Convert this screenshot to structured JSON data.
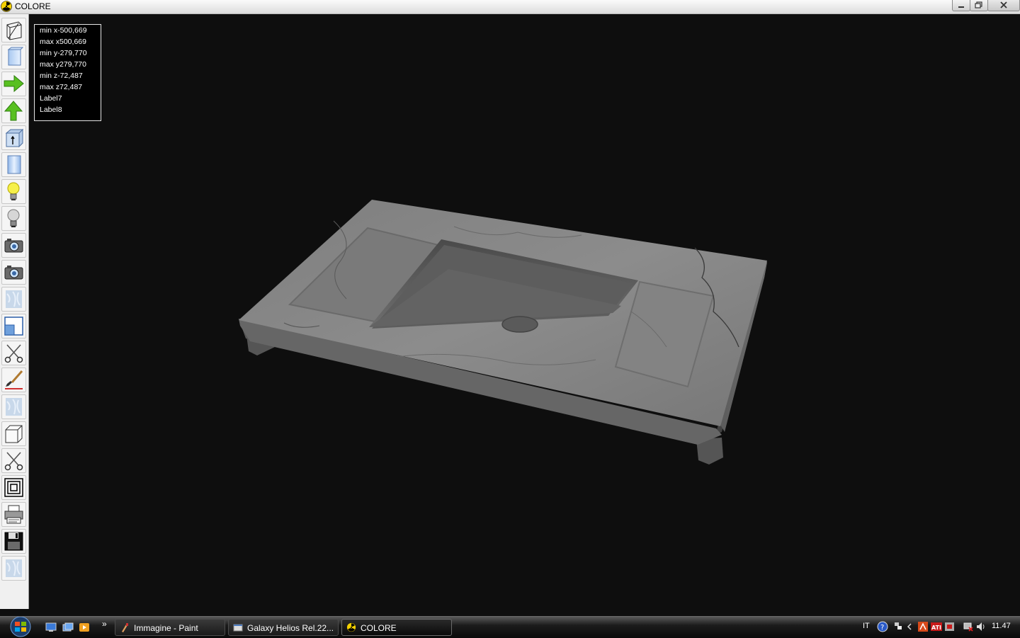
{
  "window": {
    "title": "COLORE"
  },
  "toolbar": {
    "tools": [
      {
        "icon": "wireframe-icon"
      },
      {
        "icon": "solid-view-icon"
      },
      {
        "icon": "arrow-right-icon"
      },
      {
        "icon": "arrow-up-icon"
      },
      {
        "icon": "extrude-icon"
      },
      {
        "icon": "panel-icon"
      },
      {
        "icon": "light-on-icon"
      },
      {
        "icon": "light-off-icon"
      },
      {
        "icon": "camera-icon"
      },
      {
        "icon": "camera-2-icon"
      },
      {
        "icon": "texture-icon"
      },
      {
        "icon": "viewport-icon"
      },
      {
        "icon": "scissors-icon"
      },
      {
        "icon": "brush-icon"
      },
      {
        "icon": "texture-2-icon"
      },
      {
        "icon": "box-icon"
      },
      {
        "icon": "scissors-2-icon"
      },
      {
        "icon": "frame-icon"
      },
      {
        "icon": "printer-icon"
      },
      {
        "icon": "save-icon"
      },
      {
        "icon": "texture-3-icon"
      }
    ]
  },
  "bounds": {
    "min_x": "min x-500,669",
    "max_x": "max x500,669",
    "min_y": "min y-279,770",
    "max_y": "max y279,770",
    "min_z": "min z-72,487",
    "max_z": "max z72,487",
    "label7": "Label7",
    "label8": "Label8"
  },
  "taskbar": {
    "overflow": "»",
    "buttons": [
      {
        "label": "Immagine - Paint"
      },
      {
        "label": "Galaxy Helios  Rel.22..."
      },
      {
        "label": "COLORE"
      }
    ],
    "tray": {
      "language": "IT",
      "clock": "11.47"
    }
  },
  "colors": {
    "viewport_bg": "#0e0e0e",
    "marble": "#8a8a8a"
  }
}
